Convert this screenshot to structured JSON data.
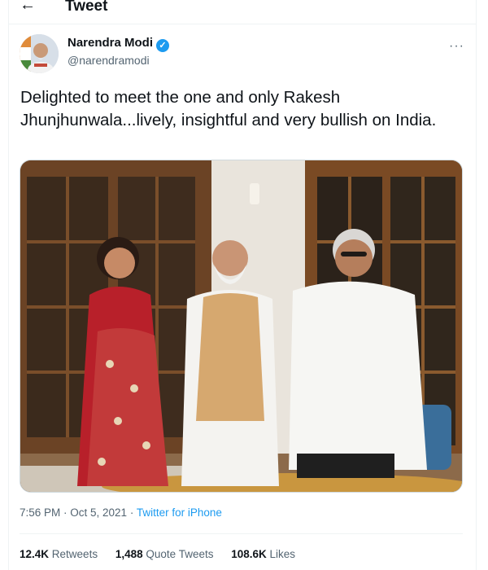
{
  "header": {
    "back_icon": "arrow-left-icon",
    "title": "Tweet"
  },
  "author": {
    "name": "Narendra Modi",
    "handle": "@narendramodi",
    "verified_icon": "verified-badge-icon"
  },
  "tweet": {
    "text": "Delighted to meet the one and only Rakesh Jhunjhunwala...lively, insightful and very bullish on India."
  },
  "meta": {
    "timestamp": "7:56 PM · Oct 5, 2021",
    "separator": " · ",
    "source": "Twitter for iPhone"
  },
  "stats": {
    "retweets_count": "12.4K",
    "retweets_label": "Retweets",
    "quotes_count": "1,488",
    "quotes_label": "Quote Tweets",
    "likes_count": "108.6K",
    "likes_label": "Likes"
  },
  "colors": {
    "accent": "#1d9bf0",
    "secondary_text": "#536471",
    "primary_text": "#0f1419"
  }
}
